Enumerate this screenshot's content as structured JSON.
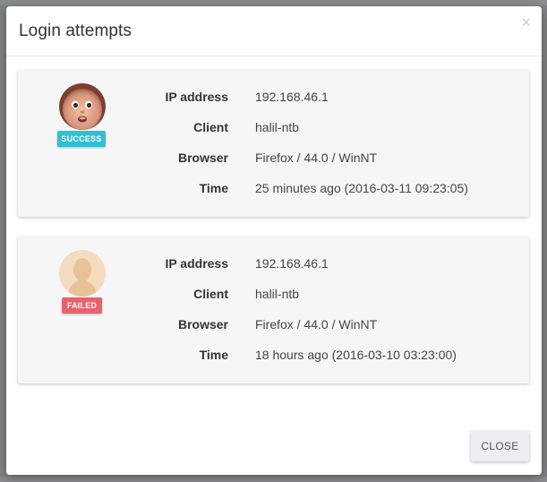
{
  "modal": {
    "title": "Login attempts",
    "close_icon": "×",
    "footer_button": "CLOSE"
  },
  "attempts": [
    {
      "status": "SUCCESS",
      "avatar": "baby-photo-avatar",
      "fields": [
        {
          "label": "IP address",
          "value": "192.168.46.1"
        },
        {
          "label": "Client",
          "value": "halil-ntb"
        },
        {
          "label": "Browser",
          "value": "Firefox / 44.0 / WinNT"
        },
        {
          "label": "Time",
          "value": "25 minutes ago (2016-03-11 09:23:05)"
        }
      ]
    },
    {
      "status": "FAILED",
      "avatar": "default-user-avatar",
      "fields": [
        {
          "label": "IP address",
          "value": "192.168.46.1"
        },
        {
          "label": "Client",
          "value": "halil-ntb"
        },
        {
          "label": "Browser",
          "value": "Firefox / 44.0 / WinNT"
        },
        {
          "label": "Time",
          "value": "18 hours ago (2016-03-10 03:23:00)"
        }
      ]
    }
  ],
  "colors": {
    "success": "#2fc1d3",
    "failed": "#e6636e"
  }
}
